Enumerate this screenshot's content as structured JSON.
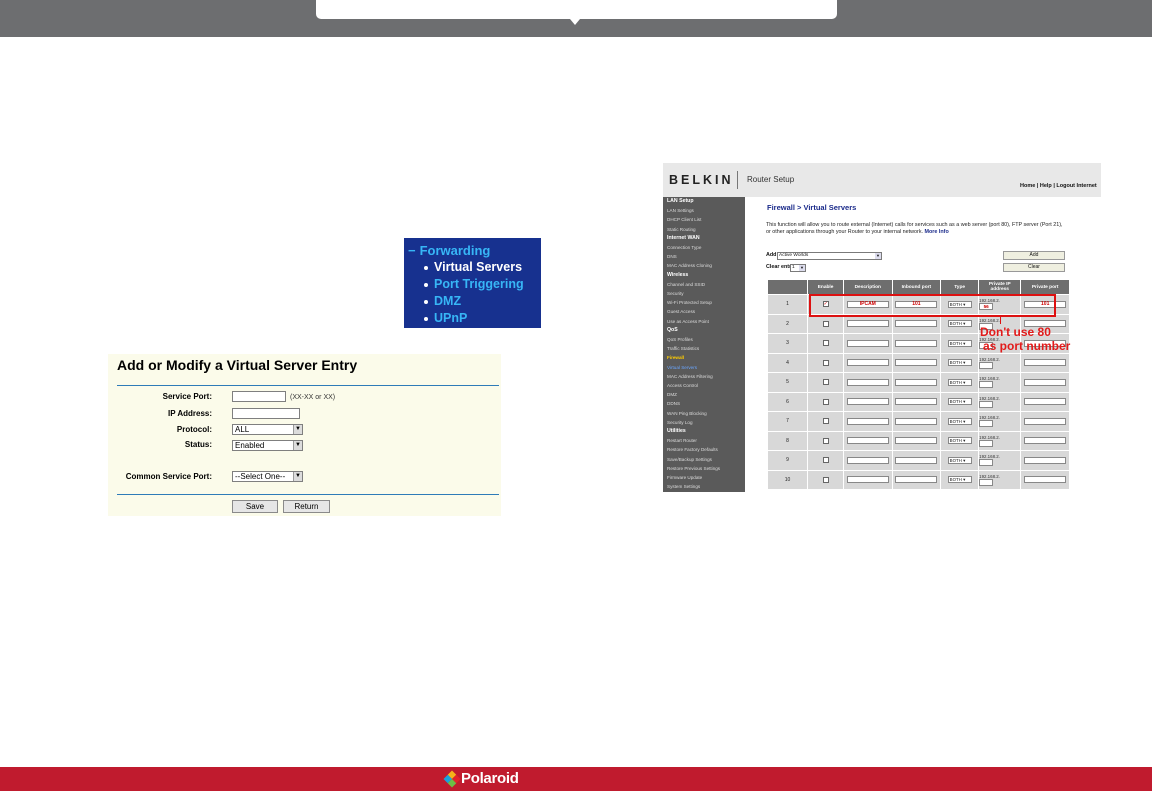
{
  "colors": {
    "topbar": "#6d6e70",
    "footer": "#c01b2e",
    "highlight": "#d11111"
  },
  "footer": {
    "brand": "Polaroid"
  },
  "forwarding": {
    "heading": "Forwarding",
    "items": [
      "Virtual Servers",
      "Port Triggering",
      "DMZ",
      "UPnP"
    ],
    "active": "Virtual Servers"
  },
  "tplink": {
    "title": "Add or Modify a Virtual Server Entry",
    "service_port_label": "Service Port:",
    "service_port_value": "",
    "service_port_hint": "(XX-XX or XX)",
    "ip_label": "IP Address:",
    "ip_value": "",
    "protocol_label": "Protocol:",
    "protocol_value": "ALL",
    "status_label": "Status:",
    "status_value": "Enabled",
    "common_label": "Common Service Port:",
    "common_value": "--Select One--",
    "save_label": "Save",
    "return_label": "Return"
  },
  "belkin": {
    "brand": "BELKIN",
    "app_title": "Router Setup",
    "top_links": "Home | Help | Logout  Internet",
    "breadcrumb": "Firewall > Virtual Servers",
    "description": "This function will allow you to route external (Internet) calls for services such as a web server (port 80), FTP server (Port 21), or other applications through your Router to your internal network.",
    "more_info": "More Info",
    "add_label": "Add",
    "add_select": "Active Worlds",
    "clear_label": "Clear entry",
    "clear_select": "1",
    "add_button": "Add",
    "clear_button": "Clear",
    "sidebar": [
      {
        "t": "LAN Setup",
        "k": "sec"
      },
      {
        "t": "LAN Settings"
      },
      {
        "t": "DHCP Client List"
      },
      {
        "t": "Static Routing"
      },
      {
        "t": "Internet WAN",
        "k": "sec"
      },
      {
        "t": "Connection Type"
      },
      {
        "t": "DNS"
      },
      {
        "t": "MAC Address Cloning"
      },
      {
        "t": "Wireless",
        "k": "sec"
      },
      {
        "t": "Channel and SSID"
      },
      {
        "t": "Security"
      },
      {
        "t": "Wi-Fi Protected Setup"
      },
      {
        "t": "Guest Access"
      },
      {
        "t": "Use as Access Point"
      },
      {
        "t": "QoS",
        "k": "sec"
      },
      {
        "t": "QoS Profiles"
      },
      {
        "t": "Traffic Statistics"
      },
      {
        "t": "Firewall",
        "k": "cur"
      },
      {
        "t": "Virtual Servers",
        "k": "sel"
      },
      {
        "t": "MAC Address Filtering"
      },
      {
        "t": "Access Control"
      },
      {
        "t": "DMZ"
      },
      {
        "t": "DDNS"
      },
      {
        "t": "WAN Ping Blocking"
      },
      {
        "t": "Security Log"
      },
      {
        "t": "Utilities",
        "k": "sec"
      },
      {
        "t": "Restart Router"
      },
      {
        "t": "Restore Factory Defaults"
      },
      {
        "t": "Save/Backup Settings"
      },
      {
        "t": "Restore Previous Settings"
      },
      {
        "t": "Firmware Update"
      },
      {
        "t": "System Settings"
      }
    ],
    "columns": [
      "",
      "Enable",
      "Description",
      "Inbound port",
      "Type",
      "Private IP address",
      "Private port"
    ],
    "rows": [
      {
        "n": "1",
        "enabled": true,
        "desc": "IPCAM",
        "inbound": "101",
        "type": "BOTH",
        "ip_prefix": "192.168.2.",
        "ip_last": "56",
        "private": "101"
      },
      {
        "n": "2",
        "enabled": false,
        "desc": "",
        "inbound": "",
        "type": "BOTH",
        "ip_prefix": "192.168.2.",
        "ip_last": "",
        "private": ""
      },
      {
        "n": "3",
        "enabled": false,
        "desc": "",
        "inbound": "",
        "type": "BOTH",
        "ip_prefix": "192.168.2.",
        "ip_last": "",
        "private": ""
      },
      {
        "n": "4",
        "enabled": false,
        "desc": "",
        "inbound": "",
        "type": "BOTH",
        "ip_prefix": "192.168.2.",
        "ip_last": "",
        "private": ""
      },
      {
        "n": "5",
        "enabled": false,
        "desc": "",
        "inbound": "",
        "type": "BOTH",
        "ip_prefix": "192.168.2.",
        "ip_last": "",
        "private": ""
      },
      {
        "n": "6",
        "enabled": false,
        "desc": "",
        "inbound": "",
        "type": "BOTH",
        "ip_prefix": "192.168.2.",
        "ip_last": "",
        "private": ""
      },
      {
        "n": "7",
        "enabled": false,
        "desc": "",
        "inbound": "",
        "type": "BOTH",
        "ip_prefix": "192.168.2.",
        "ip_last": "",
        "private": ""
      },
      {
        "n": "8",
        "enabled": false,
        "desc": "",
        "inbound": "",
        "type": "BOTH",
        "ip_prefix": "192.168.2.",
        "ip_last": "",
        "private": ""
      },
      {
        "n": "9",
        "enabled": false,
        "desc": "",
        "inbound": "",
        "type": "BOTH",
        "ip_prefix": "192.168.2.",
        "ip_last": "",
        "private": ""
      },
      {
        "n": "10",
        "enabled": false,
        "desc": "",
        "inbound": "",
        "type": "BOTH",
        "ip_prefix": "192.168.2.",
        "ip_last": "",
        "private": ""
      }
    ],
    "note_line1": "Don't use 80",
    "note_line2": "as port number"
  }
}
